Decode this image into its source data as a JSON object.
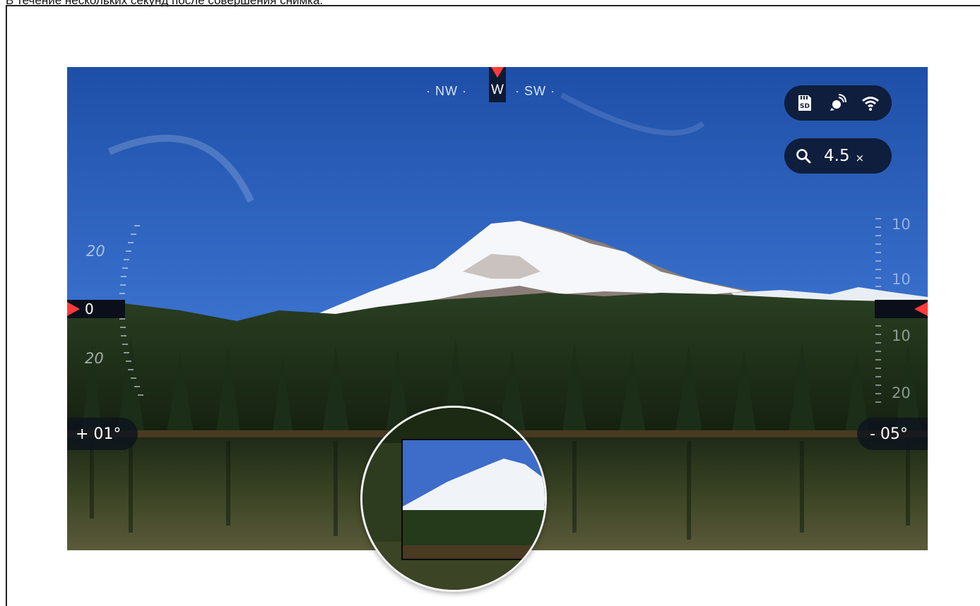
{
  "caption": "В течение нескольких секунд после совершения снимка.",
  "compass": {
    "left_text": "· NW ·",
    "heading": "W",
    "right_text": "· SW ·"
  },
  "status_icons": [
    "sd-card-icon",
    "satellite-icon",
    "wifi-icon"
  ],
  "zoom": {
    "icon": "magnifier-icon",
    "value": "4.5",
    "unit": "×"
  },
  "tilt": {
    "left_value": "+ 01°",
    "right_value": "- 05°"
  },
  "level": {
    "left_value": "0"
  },
  "left_scale": {
    "upper": "20",
    "lower": "20"
  },
  "right_scale": {
    "top": "10",
    "upper": "10",
    "lower": "10",
    "bottom": "20"
  },
  "colors": {
    "accent": "#ff3b3b",
    "hud_background": "#0f1e3c"
  }
}
